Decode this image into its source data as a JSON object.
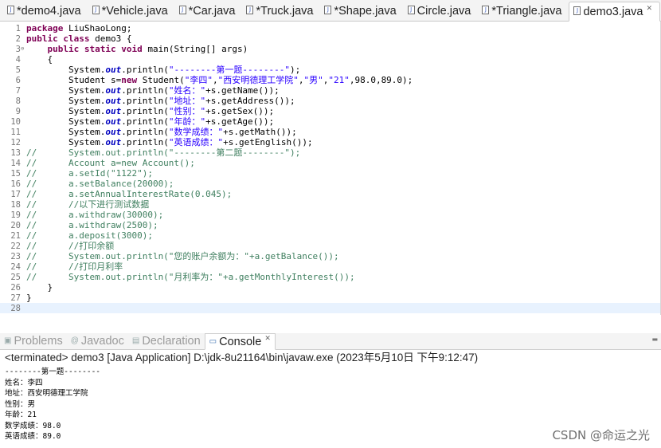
{
  "editor_tabs": [
    {
      "label": "*demo4.java",
      "active": false
    },
    {
      "label": "*Vehicle.java",
      "active": false
    },
    {
      "label": "*Car.java",
      "active": false
    },
    {
      "label": "*Truck.java",
      "active": false
    },
    {
      "label": "*Shape.java",
      "active": false
    },
    {
      "label": "Circle.java",
      "active": false
    },
    {
      "label": "*Triangle.java",
      "active": false
    },
    {
      "label": "demo3.java",
      "active": true
    }
  ],
  "tab_icon": "java-file-icon",
  "code_lines": [
    {
      "n": "1",
      "html": "<span class=\"kw\">package</span> LiuShaoLong;"
    },
    {
      "n": "2",
      "html": "<span class=\"kw\">public</span> <span class=\"kw\">class</span> demo3 {"
    },
    {
      "n": "3",
      "fold": true,
      "html": "    <span class=\"kw\">public</span> <span class=\"kw\">static</span> <span class=\"kw\">void</span> main(String[] args)"
    },
    {
      "n": "4",
      "html": "    {"
    },
    {
      "n": "5",
      "html": "        System.<span class=\"fld\">out</span>.println(<span class=\"str\">\"--------第一题--------\"</span>);"
    },
    {
      "n": "6",
      "html": "        Student s=<span class=\"kw\">new</span> Student(<span class=\"str\">\"李四\"</span>,<span class=\"str\">\"西安明德理工学院\"</span>,<span class=\"str\">\"男\"</span>,<span class=\"str\">\"21\"</span>,98.0,89.0);"
    },
    {
      "n": "7",
      "html": "        System.<span class=\"fld\">out</span>.println(<span class=\"str\">\"姓名：\"</span>+s.getName());"
    },
    {
      "n": "8",
      "html": "        System.<span class=\"fld\">out</span>.println(<span class=\"str\">\"地址：\"</span>+s.getAddress());"
    },
    {
      "n": "9",
      "html": "        System.<span class=\"fld\">out</span>.println(<span class=\"str\">\"性别：\"</span>+s.getSex());"
    },
    {
      "n": "10",
      "html": "        System.<span class=\"fld\">out</span>.println(<span class=\"str\">\"年龄：\"</span>+s.getAge());"
    },
    {
      "n": "11",
      "html": "        System.<span class=\"fld\">out</span>.println(<span class=\"str\">\"数学成绩：\"</span>+s.getMath());"
    },
    {
      "n": "12",
      "html": "        System.<span class=\"fld\">out</span>.println(<span class=\"str\">\"英语成绩：\"</span>+s.getEnglish());"
    },
    {
      "n": "13",
      "html": "<span class=\"cmt\">//      System.out.println(\"--------第二题--------\");</span>"
    },
    {
      "n": "14",
      "html": "<span class=\"cmt\">//      Account a=new Account();</span>"
    },
    {
      "n": "15",
      "html": "<span class=\"cmt\">//      a.setId(\"1122\");</span>"
    },
    {
      "n": "16",
      "html": "<span class=\"cmt\">//      a.setBalance(20000);</span>"
    },
    {
      "n": "17",
      "html": "<span class=\"cmt\">//      a.setAnnualInterestRate(0.045);</span>"
    },
    {
      "n": "18",
      "html": "<span class=\"cmt\">//      //以下进行测试数据</span>"
    },
    {
      "n": "19",
      "html": "<span class=\"cmt\">//      a.withdraw(30000);</span>"
    },
    {
      "n": "20",
      "html": "<span class=\"cmt\">//      a.withdraw(2500);</span>"
    },
    {
      "n": "21",
      "html": "<span class=\"cmt\">//      a.deposit(3000);</span>"
    },
    {
      "n": "22",
      "html": "<span class=\"cmt\">//      //打印余额</span>"
    },
    {
      "n": "23",
      "html": "<span class=\"cmt\">//      System.out.println(\"您的账户余额为：\"+a.getBalance());</span>"
    },
    {
      "n": "24",
      "html": "<span class=\"cmt\">//      //打印月利率</span>"
    },
    {
      "n": "25",
      "html": "<span class=\"cmt\">//      System.out.println(\"月利率为：\"+a.getMonthlyInterest());</span>"
    },
    {
      "n": "26",
      "html": "    }"
    },
    {
      "n": "27",
      "html": "}"
    },
    {
      "n": "28",
      "html": "",
      "current": true
    }
  ],
  "panel_tabs": [
    {
      "label": "Problems",
      "icon": "problems-icon",
      "glyph": "▣",
      "active": false
    },
    {
      "label": "Javadoc",
      "icon": "javadoc-icon",
      "glyph": "@",
      "active": false
    },
    {
      "label": "Declaration",
      "icon": "declaration-icon",
      "glyph": "▤",
      "active": false
    },
    {
      "label": "Console",
      "icon": "console-icon",
      "glyph": "▭",
      "active": true
    }
  ],
  "console": {
    "header": "<terminated> demo3 [Java Application] D:\\jdk-8u21164\\bin\\javaw.exe  (2023年5月10日 下午9:12:47)",
    "output": [
      "--------第一题--------",
      "姓名：李四",
      "地址：西安明德理工学院",
      "性别：男",
      "年龄：21",
      "数学成绩：98.0",
      "英语成绩：89.0"
    ]
  },
  "watermark": "CSDN @命运之光"
}
